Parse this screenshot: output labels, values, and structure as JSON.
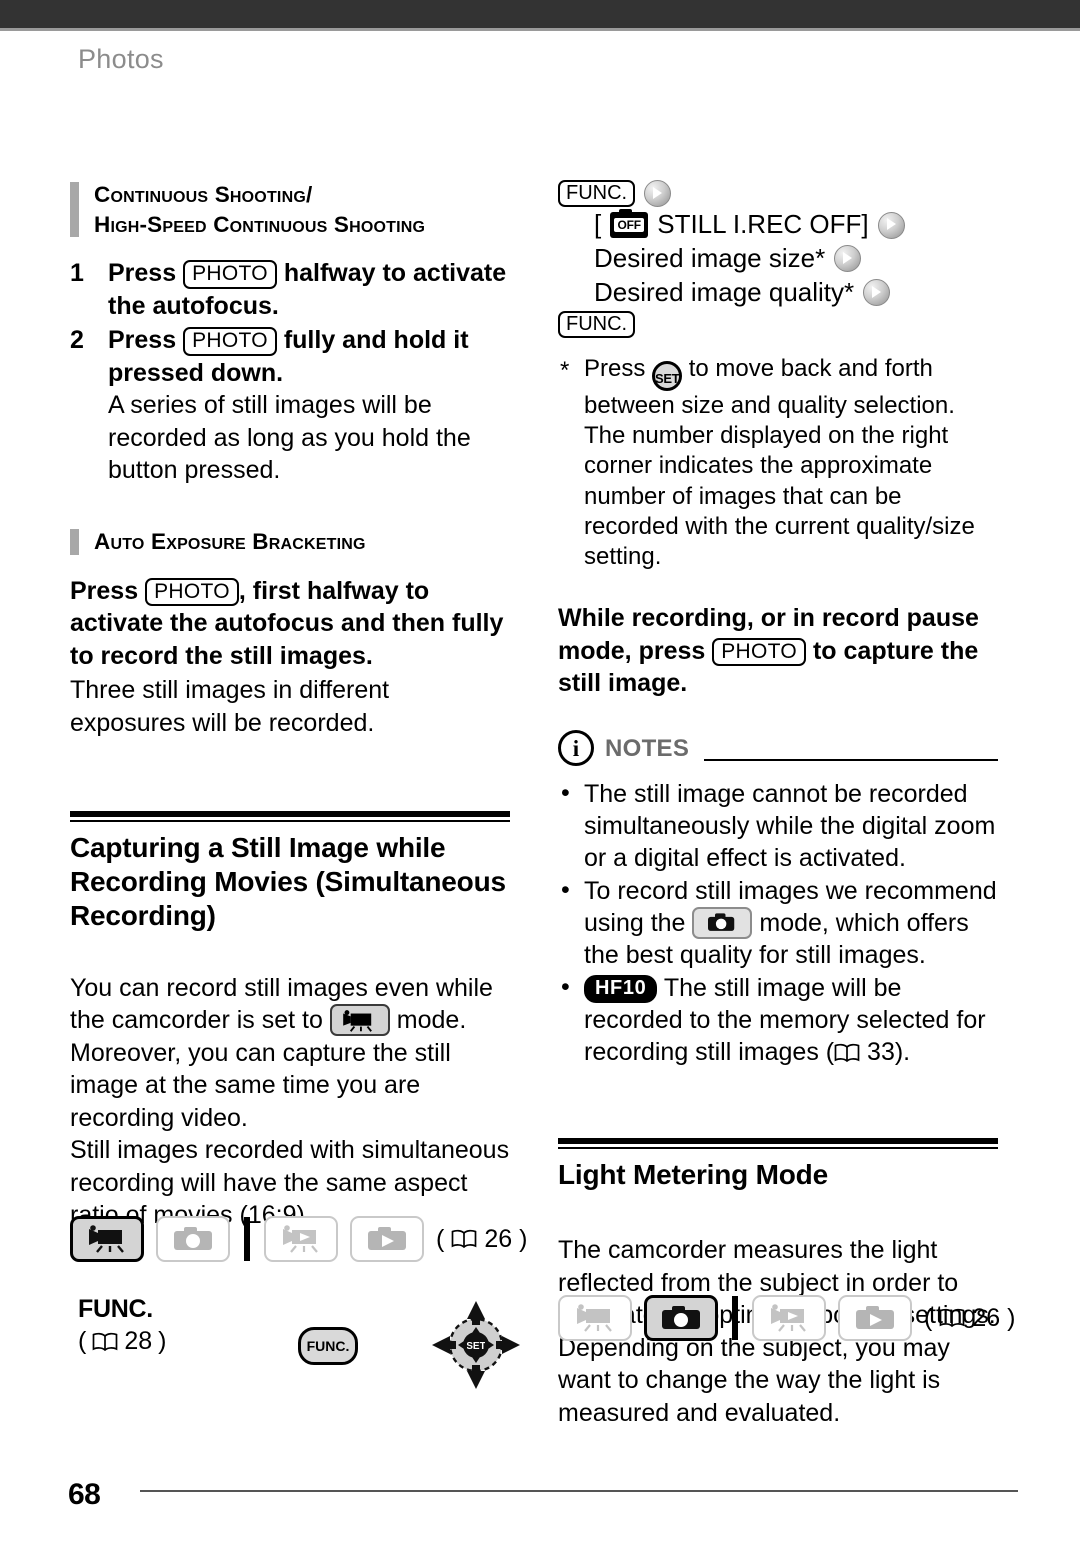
{
  "page": {
    "running_head": "Photos",
    "page_number": "68"
  },
  "left_column": {
    "subhead_1": {
      "line1": "Continuous Shooting/",
      "line2": "High-Speed Continuous Shooting"
    },
    "steps": [
      {
        "num": "1",
        "text_before": "Press",
        "keycap": "PHOTO",
        "text_after": "halfway to activate the autofocus."
      },
      {
        "num": "2",
        "text_before": "Press",
        "keycap": "PHOTO",
        "text_after": "fully and hold it pressed down.",
        "note": "A series of still images will be recorded as long as you hold the button pressed."
      }
    ],
    "subhead_2": {
      "line1": "Auto Exposure Bracketing"
    },
    "aeb_bold_before": "Press",
    "aeb_keycap": "PHOTO",
    "aeb_bold_after": ", first halfway to activate the autofocus and then fully to record the still images.",
    "aeb_note": "Three still images in different exposures will be recorded.",
    "section": {
      "title": "Capturing a Still Image while Recording Movies (Simultaneous Recording)",
      "para1_before": "You can record still images even while the camcorder is set to",
      "para1_after": "mode. Moreover, you can capture the still image at the same time you are recording video.",
      "para2": "Still images recorded with simultaneous recording will have the same aspect ratio of movies (16:9)."
    },
    "modebar": {
      "buttons": [
        {
          "icon": "movie-record-icon",
          "active": true
        },
        {
          "icon": "photo-record-icon",
          "active": false
        },
        {
          "icon": "movie-play-icon",
          "active": false
        },
        {
          "icon": "photo-play-icon",
          "active": false
        }
      ],
      "pageref_open": "(",
      "pageref_icon": "book-icon",
      "pageref_num": "26",
      "pageref_close": ")"
    },
    "func_block": {
      "label": "FUNC.",
      "pageref_open": "(",
      "pageref_num": "28",
      "pageref_close": ")",
      "pill_label": "FUNC.",
      "joystick_label": "SET"
    }
  },
  "right_column": {
    "menu_flow": {
      "func_start": "FUNC.",
      "items": [
        {
          "off_icon": "OFF",
          "label": "STILL I.REC OFF]",
          "bracket_open": "["
        },
        {
          "label": "Desired image size*"
        },
        {
          "label": "Desired image quality*"
        }
      ],
      "func_end": "FUNC."
    },
    "footnote": {
      "marker": "*",
      "before": "Press",
      "set_label": "SET",
      "after": "to move back and forth between size and quality selection. The number displayed on the right corner indicates the approximate number of images that can be recorded with the current quality/size setting."
    },
    "bold_para": {
      "before": "While recording, or in record pause mode, press",
      "keycap": "PHOTO",
      "after": "to capture the still image."
    },
    "notes": {
      "icon": "info-icon",
      "title": "NOTES",
      "items": [
        {
          "text": "The still image cannot be recorded simultaneously while the digital zoom or a digital effect is activated."
        },
        {
          "text_before": "To record still images we recommend using the",
          "inline_icon": "photo-record-icon",
          "text_after": "mode, which offers the best quality for still images."
        },
        {
          "badge": "HF10",
          "text_before": "The still image will be recorded to the memory selected for recording still images (",
          "pageref_num": "33",
          "text_after": ")."
        }
      ]
    },
    "section": {
      "title": "Light Metering Mode",
      "para": "The camcorder measures the light reflected from the subject in order to calculate the optimal exposure settings. Depending on the subject, you may want to change the way the light is measured and evaluated."
    },
    "modebar": {
      "buttons": [
        {
          "icon": "movie-record-icon",
          "active": false
        },
        {
          "icon": "photo-record-icon",
          "active": true
        },
        {
          "icon": "movie-play-icon",
          "active": false
        },
        {
          "icon": "photo-play-icon",
          "active": false
        }
      ],
      "pageref_open": "(",
      "pageref_icon": "book-icon",
      "pageref_num": "26",
      "pageref_close": ")"
    }
  }
}
